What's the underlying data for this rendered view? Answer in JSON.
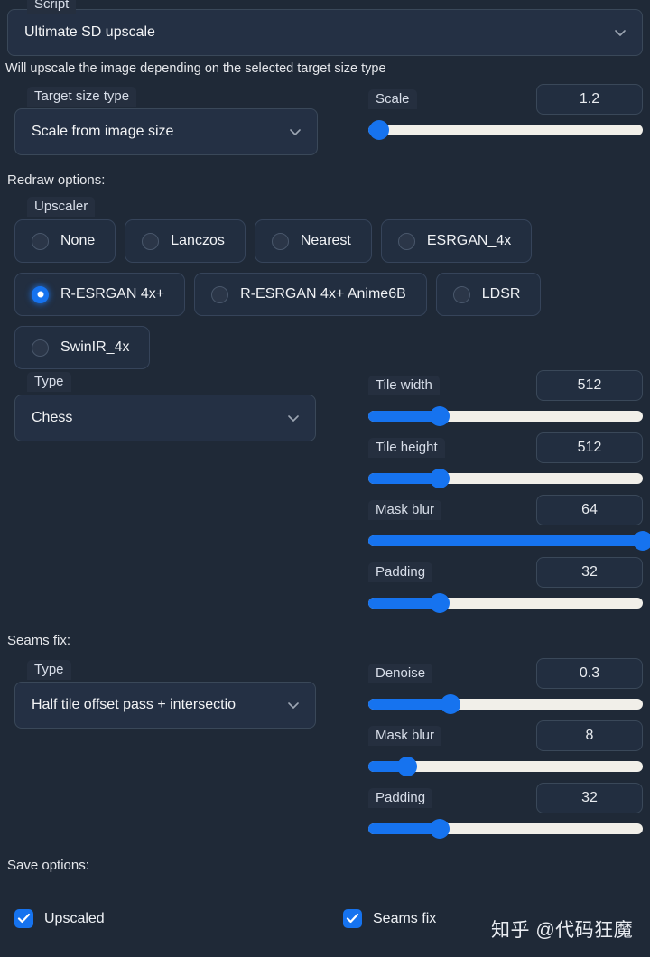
{
  "script": {
    "label": "Script",
    "selected": "Ultimate SD upscale",
    "chevron_icon": "chevron-down-icon"
  },
  "helper_text": "Will upscale the image depending on the selected target size type",
  "target_size_type": {
    "label": "Target size type",
    "selected": "Scale from image size",
    "chevron_icon": "chevron-down-icon"
  },
  "scale": {
    "label": "Scale",
    "value": "1.2",
    "fill_percent": 4
  },
  "redraw": {
    "heading": "Redraw options:",
    "upscaler_label": "Upscaler",
    "options": [
      {
        "label": "None",
        "selected": false
      },
      {
        "label": "Lanczos",
        "selected": false
      },
      {
        "label": "Nearest",
        "selected": false
      },
      {
        "label": "ESRGAN_4x",
        "selected": false
      },
      {
        "label": "R-ESRGAN 4x+",
        "selected": true
      },
      {
        "label": "R-ESRGAN 4x+ Anime6B",
        "selected": false
      },
      {
        "label": "LDSR",
        "selected": false
      },
      {
        "label": "SwinIR_4x",
        "selected": false
      }
    ],
    "type_label": "Type",
    "type_selected": "Chess",
    "sliders": [
      {
        "label": "Tile width",
        "value": "512",
        "fill_percent": 26
      },
      {
        "label": "Tile height",
        "value": "512",
        "fill_percent": 26
      },
      {
        "label": "Mask blur",
        "value": "64",
        "fill_percent": 100
      },
      {
        "label": "Padding",
        "value": "32",
        "fill_percent": 26
      }
    ]
  },
  "seams_fix": {
    "heading": "Seams fix:",
    "type_label": "Type",
    "type_selected": "Half tile offset pass + intersectio",
    "sliders": [
      {
        "label": "Denoise",
        "value": "0.3",
        "fill_percent": 30
      },
      {
        "label": "Mask blur",
        "value": "8",
        "fill_percent": 14
      },
      {
        "label": "Padding",
        "value": "32",
        "fill_percent": 26
      }
    ]
  },
  "save_options": {
    "heading": "Save options:",
    "items": [
      {
        "label": "Upscaled",
        "checked": true
      },
      {
        "label": "Seams fix",
        "checked": true
      }
    ]
  },
  "watermark": "知乎 @代码狂魔",
  "colors": {
    "background": "#1f2937",
    "panel": "#222e40",
    "accent": "#1673ef",
    "track": "#f1efe9",
    "border": "#36445a",
    "text": "#e5e7eb"
  }
}
